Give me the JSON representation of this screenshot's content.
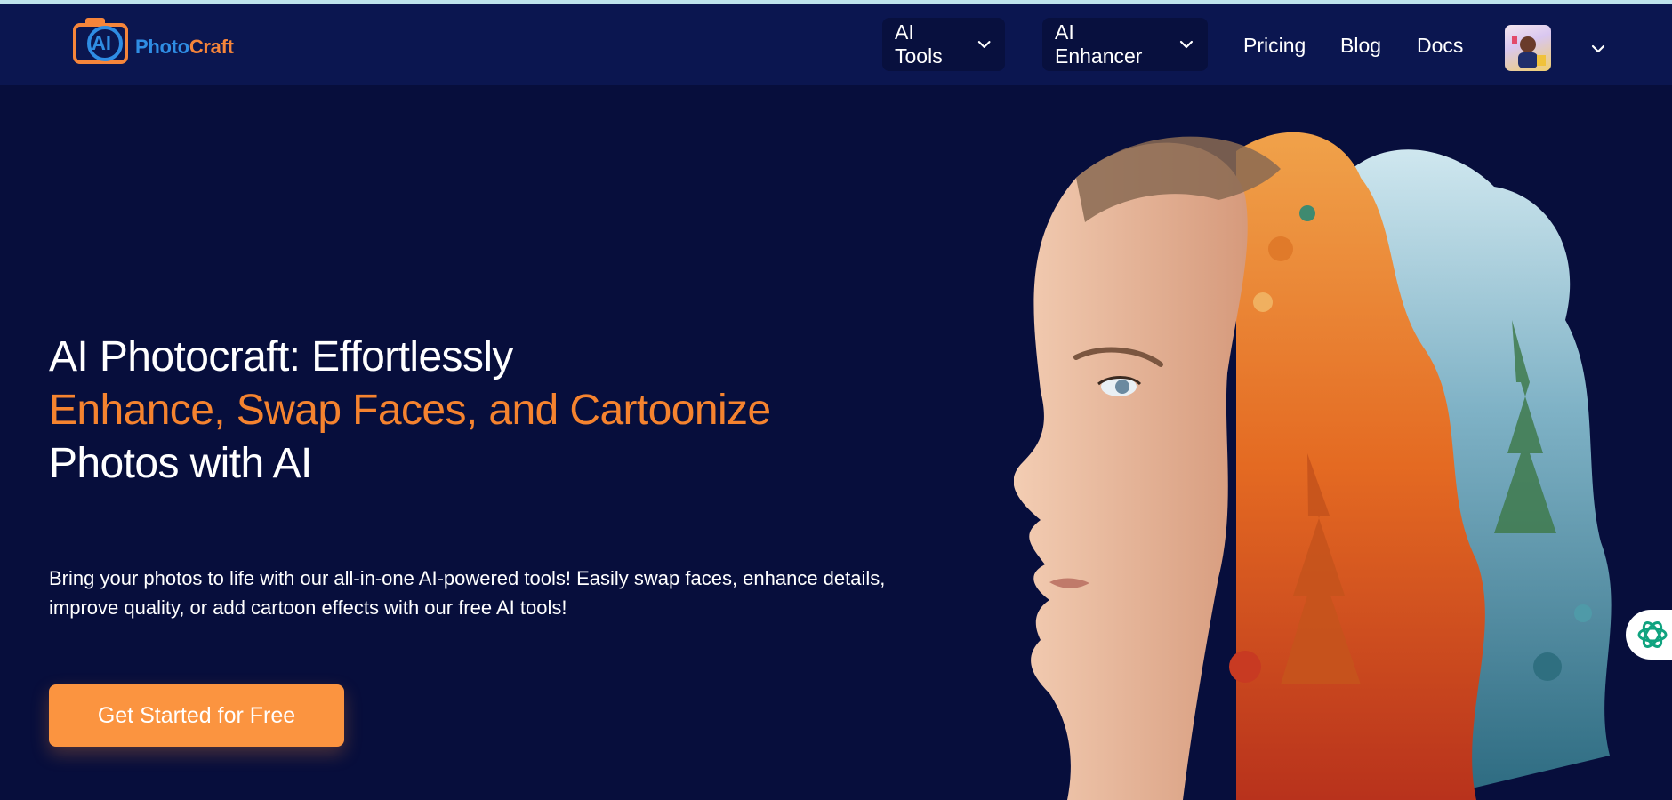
{
  "brand": {
    "prefix": "AI",
    "name_part1": "Photo",
    "name_part2": "Craft",
    "color_blue": "#2f8de4",
    "color_orange": "#f6853a"
  },
  "nav": {
    "menus": [
      {
        "label": "AI Tools",
        "icon": "chevron-down-icon"
      },
      {
        "label": "AI Enhancer",
        "icon": "chevron-down-icon"
      }
    ],
    "links": [
      {
        "label": "Pricing"
      },
      {
        "label": "Blog"
      },
      {
        "label": "Docs"
      }
    ],
    "user_menu_icon": "chevron-down-icon"
  },
  "hero": {
    "title_line1": "AI Photocraft: Effortlessly",
    "title_line2": "Enhance, Swap Faces, and Cartoonize",
    "title_line3": "Photos with AI",
    "description": "Bring your photos to life with our all-in-one AI-powered tools! Easily swap faces, enhance details, improve quality, or add cartoon effects with our free AI tools!",
    "cta_label": "Get Started for Free",
    "accent_color": "#f5832f",
    "cta_color": "#fb9440"
  },
  "colors": {
    "background": "#070e3c",
    "navbar": "#0b1650"
  },
  "side_widget": {
    "icon": "openai-logo-icon"
  }
}
